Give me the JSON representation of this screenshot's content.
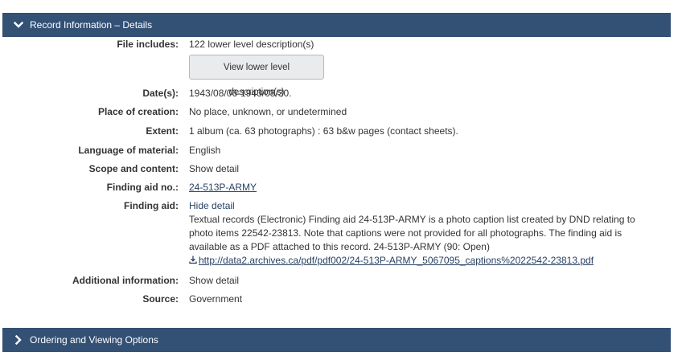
{
  "sections": {
    "details_header": "Record Information – Details",
    "ordering_header": "Ordering and Viewing Options"
  },
  "colors": {
    "header_bg": "#335075",
    "header_text": "#ffffff",
    "link": "#284162"
  },
  "icons": {
    "expanded": "chevron-down-icon",
    "collapsed": "chevron-right-icon",
    "download": "download-icon"
  },
  "fields": {
    "file_includes": {
      "label": "File includes:",
      "value": "122 lower level description(s)",
      "button": "View lower level description(s)"
    },
    "dates": {
      "label": "Date(s):",
      "value": "1943/08/06-1943/08/30."
    },
    "place": {
      "label": "Place of creation:",
      "value": "No place, unknown, or undetermined"
    },
    "extent": {
      "label": "Extent:",
      "value": "1 album (ca. 63 photographs) : 63 b&w pages (contact sheets)."
    },
    "language": {
      "label": "Language of material:",
      "value": "English"
    },
    "scope": {
      "label": "Scope and content:",
      "toggle": "Show detail"
    },
    "finding_aid_no": {
      "label": "Finding aid no.:",
      "link": "24-513P-ARMY"
    },
    "finding_aid": {
      "label": "Finding aid:",
      "toggle": "Hide detail",
      "text": "Textual records (Electronic) Finding aid 24-513P-ARMY is a photo caption list created by DND relating to photo items 22542-23813. Note that captions were not provided for all photographs. The finding aid is available as a PDF attached to this record. 24-513P-ARMY (90: Open)",
      "pdf_link": "http://data2.archives.ca/pdf/pdf002/24-513P-ARMY_5067095_captions%2022542-23813.pdf"
    },
    "additional": {
      "label": "Additional information:",
      "toggle": "Show detail"
    },
    "source": {
      "label": "Source:",
      "value": "Government"
    }
  }
}
